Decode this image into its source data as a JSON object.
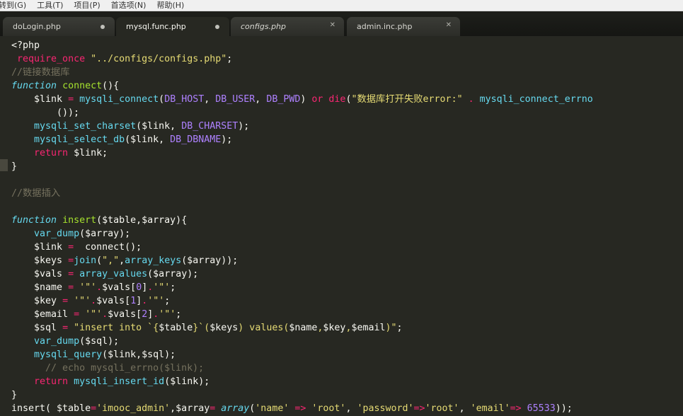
{
  "menu": {
    "items": [
      "转到(G)",
      "工具(T)",
      "项目(P)",
      "首选项(N)",
      "帮助(H)"
    ]
  },
  "tabs": [
    {
      "label": "doLogin.php",
      "state": "modified",
      "italic": false
    },
    {
      "label": "mysql.func.php",
      "state": "modified",
      "italic": false,
      "active": true
    },
    {
      "label": "configs.php",
      "state": "close",
      "italic": true
    },
    {
      "label": "admin.inc.php",
      "state": "close",
      "italic": false
    }
  ],
  "code": {
    "lines": [
      "<?php",
      " require_once \"../configs/configs.php\";",
      "//链接数据库",
      "function connect(){",
      "    $link = mysqli_connect(DB_HOST, DB_USER, DB_PWD) or die(\"数据库打开失败error:\" . mysqli_connect_errno",
      "        ());",
      "    mysqli_set_charset($link, DB_CHARSET);",
      "    mysqli_select_db($link, DB_DBNAME);",
      "    return $link;",
      "}",
      "",
      "//数据插入",
      "",
      "function insert($table,$array){",
      "    var_dump($array);",
      "    $link =  connect();",
      "    $keys =join(\",\",array_keys($array));",
      "    $vals = array_values($array);",
      "    $name = '\"'.$vals[0].'\"';",
      "    $key = '\"'.$vals[1].'\"';",
      "    $email = '\"'.$vals[2].'\"';",
      "    $sql = \"insert into `{$table}`($keys) values($name,$key,$email)\";",
      "    var_dump($sql);",
      "    mysqli_query($link,$sql);",
      "      // echo mysqli_errno($link);",
      "    return mysqli_insert_id($link);",
      "}",
      "insert( $table='imooc_admin',$array= array('name' => 'root', 'password'=>'root', 'email'=> 65533));"
    ]
  },
  "colors": {
    "background": "#272822",
    "keyword": "#f92672",
    "string": "#e6db74",
    "function": "#66d9ef",
    "comment": "#75715e",
    "constant": "#ae81ff"
  }
}
